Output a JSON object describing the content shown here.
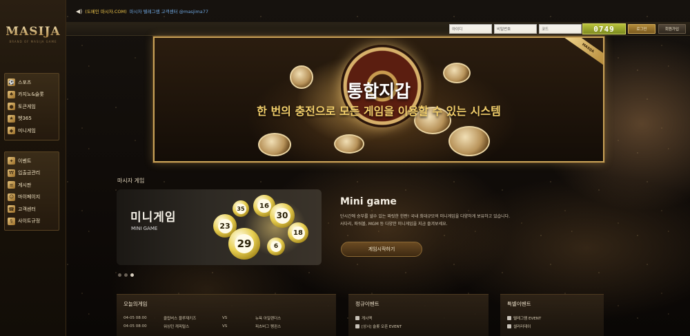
{
  "brand": {
    "logo_text": "MASIJA",
    "logo_sub": "BRAND OF MASIJA GAME"
  },
  "notice": {
    "site": "(도메인 마시자.COM)",
    "message": "마시자 텔레그램 고객센터 @masjima77"
  },
  "login": {
    "id_placeholder": "아이디",
    "pw_placeholder": "비밀번호",
    "code_placeholder": "코드",
    "captcha": "0749",
    "login_label": "로그인",
    "join_label": "회원가입"
  },
  "sidebar": {
    "group1": [
      {
        "label": "스포츠"
      },
      {
        "label": "카지노&슬롯"
      },
      {
        "label": "토큰게임"
      },
      {
        "label": "벳365"
      },
      {
        "label": "미니게임"
      }
    ],
    "group2": [
      {
        "label": "이벤트"
      },
      {
        "label": "입출금관리"
      },
      {
        "label": "게시판"
      },
      {
        "label": "마이페이지"
      },
      {
        "label": "고객센터"
      },
      {
        "label": "사이트규정"
      }
    ]
  },
  "banner": {
    "title": "통합지갑",
    "subtitle": "한 번의 충전으로 모든 게임을 이용할 수 있는 시스템",
    "ribbon": "MASIJA"
  },
  "mini_section": {
    "label": "마시자 게임",
    "card_kr": "미니게임",
    "card_en": "MINI GAME",
    "balls": [
      "35",
      "16",
      "30",
      "23",
      "18",
      "29",
      "6"
    ],
    "title": "Mini game",
    "desc_line1": "단시간에 승부를 낼수 있는 짜릿한 한판! 국내 최대규모의 미니게임을 다양하게 보유하고 있습니다.",
    "desc_line2": "사다리, 파워볼, MGM 등 다양한 미니게임을 지금 즐겨보세요.",
    "start_label": "게임시작하기"
  },
  "today": {
    "title": "오늘의게임",
    "rows": [
      {
        "time": "04-05 08:00",
        "home": "클립버스 블루재키즈",
        "vs": "VS",
        "away": "뉴욕 아일랜더스"
      },
      {
        "time": "04-05 08:00",
        "home": "워싱턴 캐피털스",
        "vs": "VS",
        "away": "피츠버그 펭귄스"
      }
    ]
  },
  "events": {
    "title": "정규이벤트",
    "rows": [
      {
        "text": "게시맥"
      },
      {
        "text": "[상시] 슬롯 오픈 EVENT"
      }
    ]
  },
  "special": {
    "title": "특별이벤트",
    "rows": [
      {
        "text": "텔레그램 EVENT"
      },
      {
        "text": "셀러리데이"
      }
    ]
  }
}
